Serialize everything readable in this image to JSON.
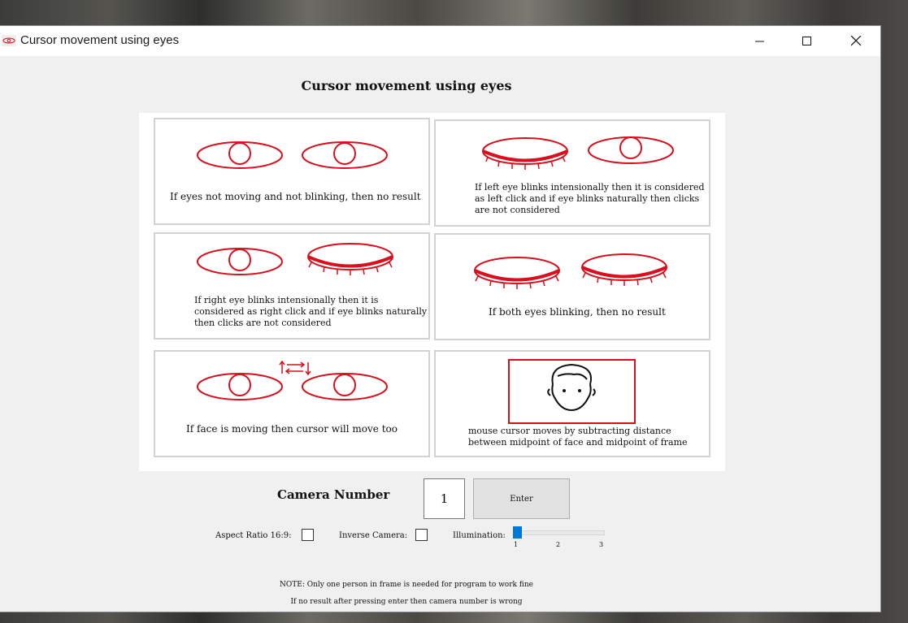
{
  "window": {
    "title": "Cursor movement using eyes",
    "icon": "eye-app-icon"
  },
  "heading": "Cursor movement using eyes",
  "panels": {
    "p1": "If eyes not moving and not blinking, then no result",
    "p2": [
      "If left eye blinks intensionally then it is considered",
      "as left click and if eye blinks naturally then clicks",
      "are not considered"
    ],
    "p3": [
      "If right eye blinks intensionally then it is",
      "considered as right click and if eye blinks naturally",
      "then clicks are not considered"
    ],
    "p4": "If both eyes blinking, then no result",
    "p5": "If face is moving then cursor will move too",
    "p6": [
      "mouse cursor moves by subtracting distance",
      "between midpoint of face and midpoint of frame"
    ]
  },
  "camera": {
    "label": "Camera Number",
    "value": "1",
    "enter_label": "Enter"
  },
  "options": {
    "aspect_label": "Aspect Ratio 16:9:",
    "inverse_label": "Inverse Camera:",
    "illumination_label": "Illumination:",
    "illumination_value": 1,
    "illumination_ticks": [
      "1",
      "2",
      "3"
    ]
  },
  "notes": {
    "line1": "NOTE: Only one person in frame is needed for program to work fine",
    "line2": "If no result after pressing enter then camera number is wrong"
  },
  "colors": {
    "accent": "#0078d7",
    "drawing": "#d8101d"
  }
}
